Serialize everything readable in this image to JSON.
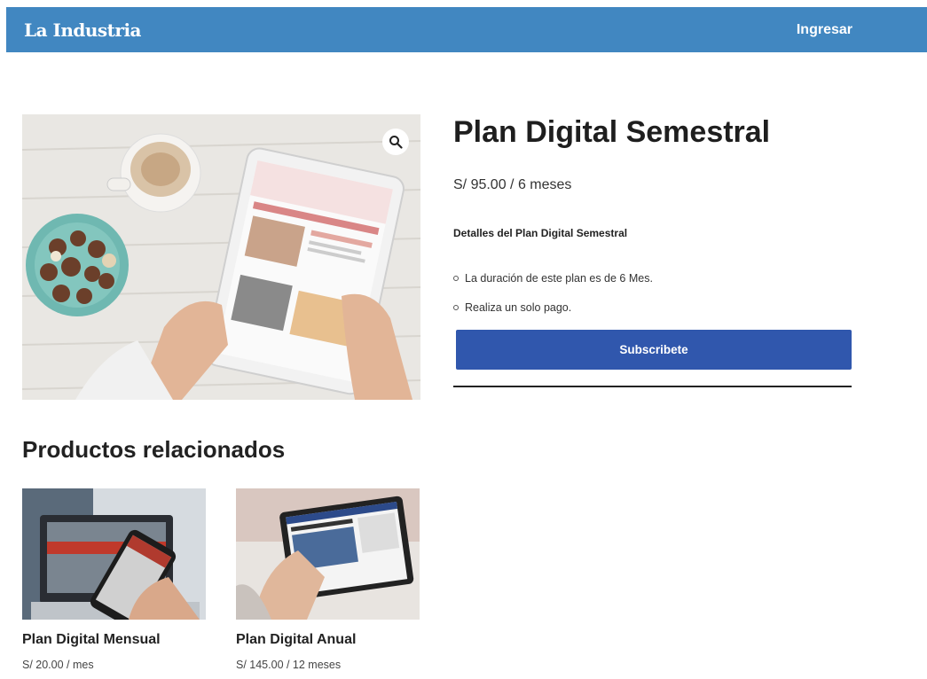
{
  "header": {
    "logo": "La Industria",
    "login_label": "Ingresar",
    "background": "#4187c1"
  },
  "product": {
    "title": "Plan Digital Semestral",
    "price": "S/ 95.00 / 6 meses",
    "details_title": "Detalles del Plan Digital Semestral",
    "features": [
      "La duración de este plan es de 6 Mes.",
      "Realiza un solo pago."
    ],
    "subscribe_label": "Subscribete",
    "zoom_icon": "magnifier-icon"
  },
  "related": {
    "title": "Productos relacionados",
    "items": [
      {
        "name": "Plan Digital Mensual",
        "price": "S/ 20.00 / mes"
      },
      {
        "name": "Plan Digital Anual",
        "price": "S/ 145.00 / 12 meses"
      }
    ]
  },
  "colors": {
    "accent": "#3057ad",
    "header": "#4187c1"
  }
}
